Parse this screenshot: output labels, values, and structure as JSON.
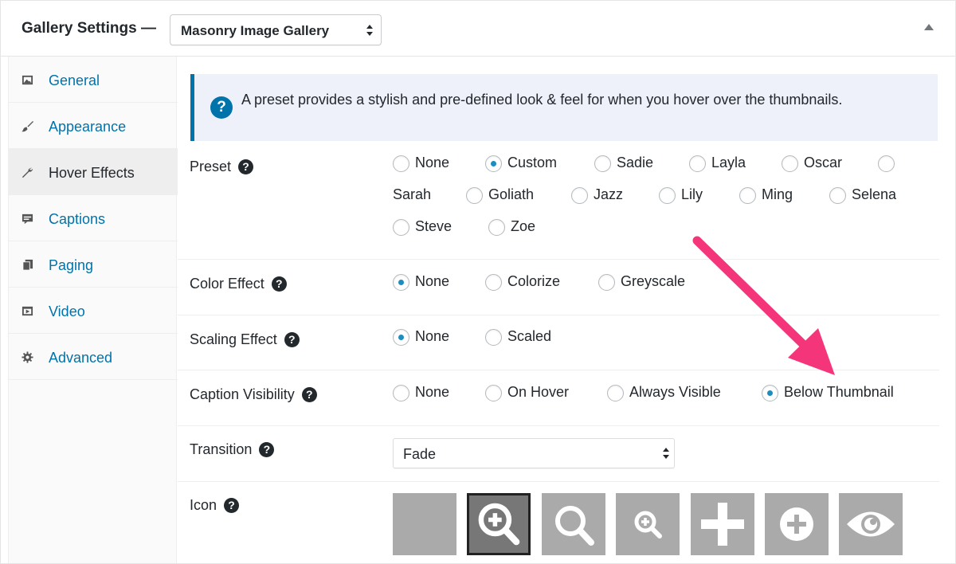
{
  "header": {
    "title": "Gallery Settings —",
    "gallery_select": "Masonry Image Gallery"
  },
  "sidebar": {
    "items": [
      {
        "label": "General",
        "icon": "image-icon"
      },
      {
        "label": "Appearance",
        "icon": "brush-icon"
      },
      {
        "label": "Hover Effects",
        "icon": "wrench-icon",
        "active": true
      },
      {
        "label": "Captions",
        "icon": "caption-icon"
      },
      {
        "label": "Paging",
        "icon": "pages-icon"
      },
      {
        "label": "Video",
        "icon": "video-icon"
      },
      {
        "label": "Advanced",
        "icon": "gear-icon"
      }
    ]
  },
  "notice": {
    "text": "A preset provides a stylish and pre-defined look & feel for when you hover over the thumbnails."
  },
  "preset": {
    "label": "Preset",
    "options": [
      "None",
      "Custom",
      "Sadie",
      "Layla",
      "Oscar",
      "Sarah",
      "Goliath",
      "Jazz",
      "Lily",
      "Ming",
      "Selena",
      "Steve",
      "Zoe"
    ],
    "selected": "Custom"
  },
  "color_effect": {
    "label": "Color Effect",
    "options": [
      "None",
      "Colorize",
      "Greyscale"
    ],
    "selected": "None"
  },
  "scaling_effect": {
    "label": "Scaling Effect",
    "options": [
      "None",
      "Scaled"
    ],
    "selected": "None"
  },
  "caption_visibility": {
    "label": "Caption Visibility",
    "options": [
      "None",
      "On Hover",
      "Always Visible",
      "Below Thumbnail"
    ],
    "selected": "Below Thumbnail"
  },
  "transition": {
    "label": "Transition",
    "value": "Fade"
  },
  "icon": {
    "label": "Icon",
    "choices": [
      "blank",
      "zoom-plus-large",
      "search",
      "zoom-plus-small",
      "plus",
      "plus-circle",
      "eye"
    ],
    "selected": "zoom-plus-large"
  },
  "colors": {
    "accent": "#0073aa",
    "arrow": "#f5357a"
  },
  "help_glyph": "?"
}
